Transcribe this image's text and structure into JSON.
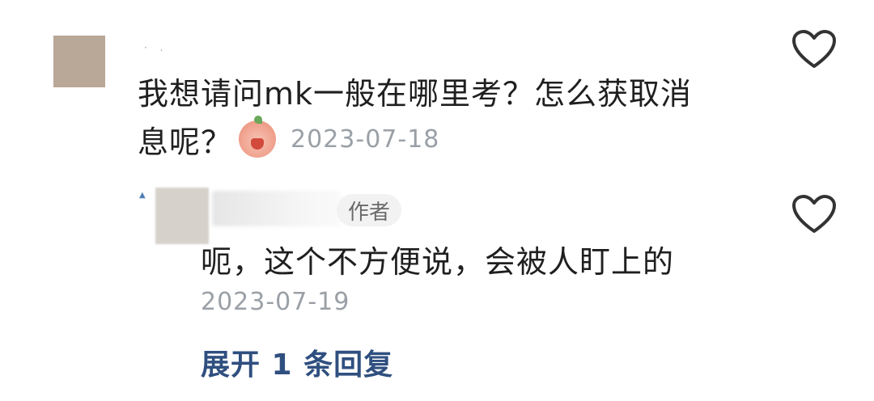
{
  "comment": {
    "username_mark": "·  .",
    "text_line1": "我想请问mk一般在哪里考？怎么获取消",
    "text_line2": "息呢？",
    "date": "2023-07-18",
    "sticker_icon": "crying-peach-sticker-icon"
  },
  "reply": {
    "username_mark": "▲",
    "author_badge": "作者",
    "text": "呃，这个不方便说，会被人盯上的",
    "date": "2023-07-19"
  },
  "expand_replies_label": "展开 1 条回复",
  "colors": {
    "link": "#2f4f7f",
    "meta_text": "#9aa0a6",
    "body_text": "#1f1f1f",
    "heart_stroke": "#333333"
  }
}
